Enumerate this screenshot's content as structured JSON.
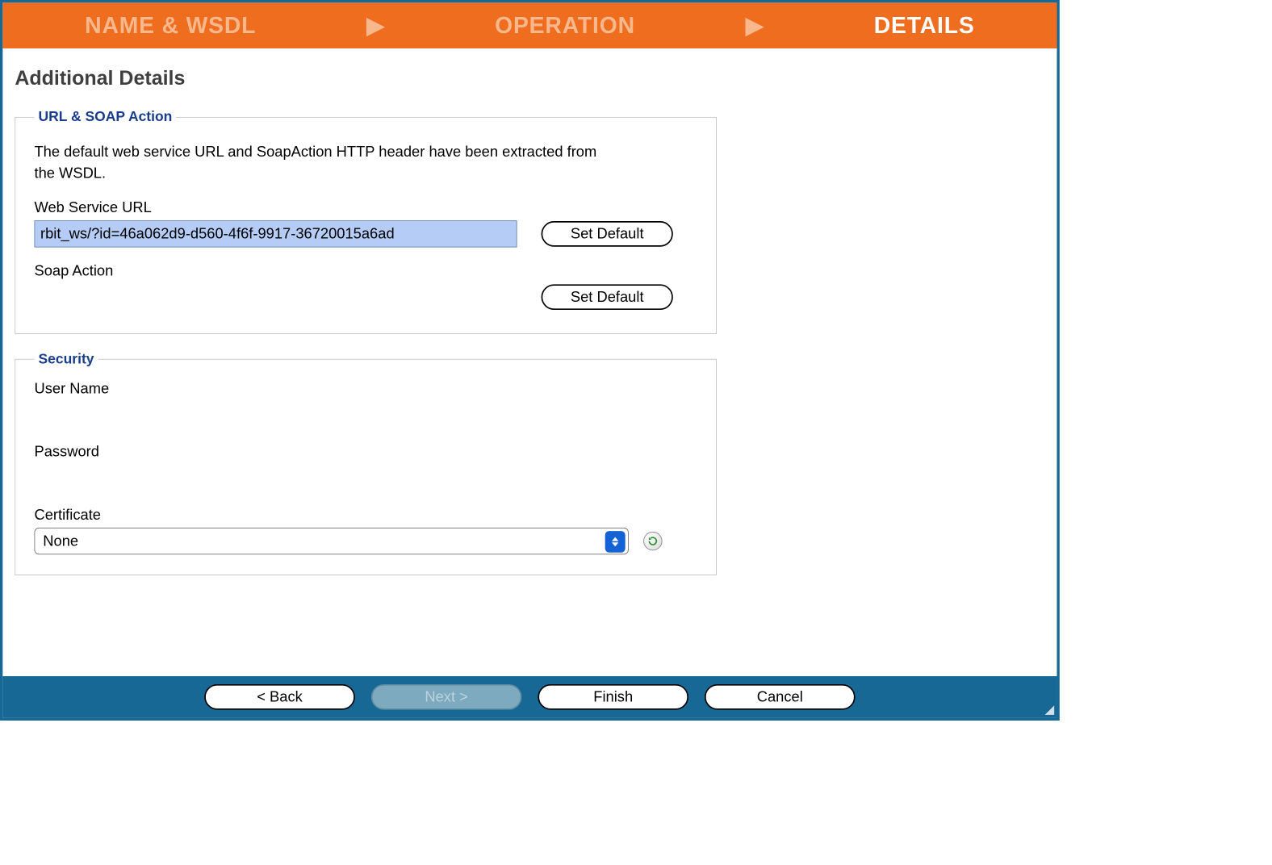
{
  "stepper": {
    "steps": [
      "NAME & WSDL",
      "OPERATION",
      "DETAILS"
    ],
    "active_index": 2
  },
  "page_title": "Additional Details",
  "url_soap": {
    "legend": "URL & SOAP Action",
    "description": "The default web service URL and SoapAction HTTP header have been extracted from the WSDL.",
    "web_service_url_label": "Web Service URL",
    "web_service_url_value": "rbit_ws/?id=46a062d9-d560-4f6f-9917-36720015a6ad",
    "set_default_label": "Set Default",
    "soap_action_label": "Soap Action",
    "soap_action_value": ""
  },
  "security": {
    "legend": "Security",
    "user_name_label": "User Name",
    "user_name_value": "",
    "password_label": "Password",
    "password_value": "",
    "certificate_label": "Certificate",
    "certificate_value": "None"
  },
  "footer": {
    "back": "< Back",
    "next": "Next >",
    "finish": "Finish",
    "cancel": "Cancel"
  }
}
